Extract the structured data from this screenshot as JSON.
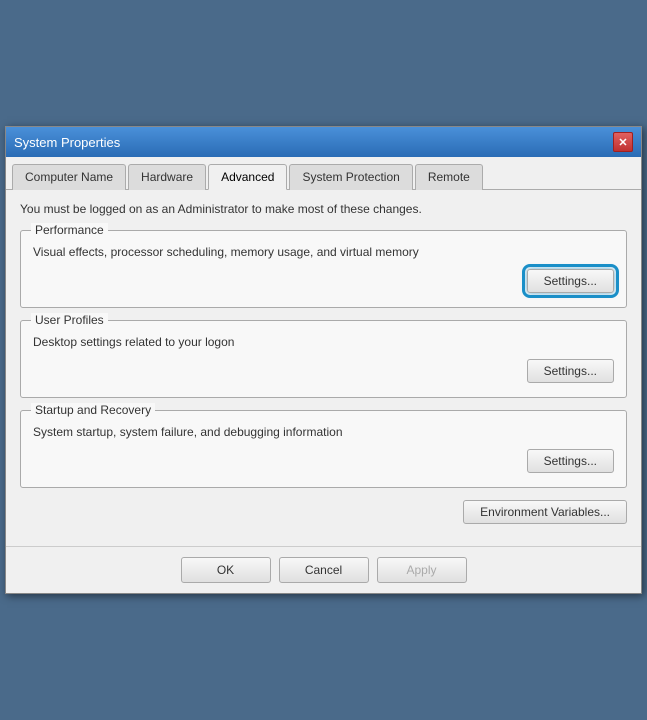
{
  "window": {
    "title": "System Properties",
    "close_icon": "✕"
  },
  "tabs": [
    {
      "id": "computer-name",
      "label": "Computer Name",
      "active": false
    },
    {
      "id": "hardware",
      "label": "Hardware",
      "active": false
    },
    {
      "id": "advanced",
      "label": "Advanced",
      "active": true
    },
    {
      "id": "system-protection",
      "label": "System Protection",
      "active": false
    },
    {
      "id": "remote",
      "label": "Remote",
      "active": false
    }
  ],
  "content": {
    "info_text": "You must be logged on as an Administrator to make most of these changes.",
    "groups": [
      {
        "id": "performance",
        "label": "Performance",
        "description": "Visual effects, processor scheduling, memory usage, and virtual memory",
        "button": "Settings..."
      },
      {
        "id": "user-profiles",
        "label": "User Profiles",
        "description": "Desktop settings related to your logon",
        "button": "Settings..."
      },
      {
        "id": "startup-recovery",
        "label": "Startup and Recovery",
        "description": "System startup, system failure, and debugging information",
        "button": "Settings..."
      }
    ],
    "env_button": "Environment Variables..."
  },
  "footer": {
    "ok_label": "OK",
    "cancel_label": "Cancel",
    "apply_label": "Apply"
  }
}
